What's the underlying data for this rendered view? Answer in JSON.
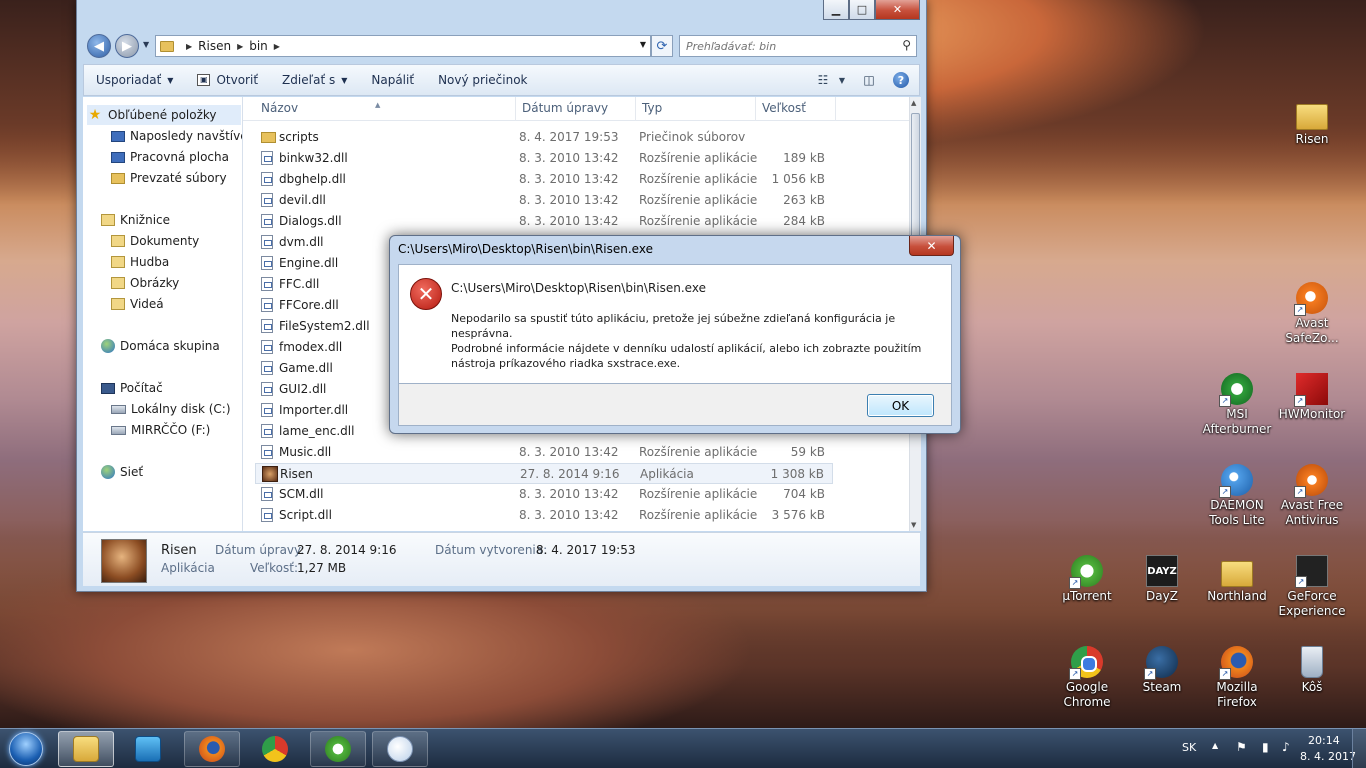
{
  "explorer": {
    "controls": {
      "minimize": "▁",
      "maximize": "□",
      "close": "✕"
    },
    "breadcrumb": [
      "Risen",
      "bin"
    ],
    "search_placeholder": "Prehľadávať: bin",
    "toolbar": {
      "organize": "Usporiadať",
      "open": "Otvoriť",
      "share": "Zdieľať s",
      "burn": "Napáliť",
      "new_folder": "Nový priečinok"
    },
    "nav": {
      "favorites": "Obľúbené položky",
      "recent": "Naposledy navštívené",
      "desktop": "Pracovná plocha",
      "downloads": "Prevzaté súbory",
      "libraries": "Knižnice",
      "documents": "Dokumenty",
      "music": "Hudba",
      "pictures": "Obrázky",
      "videos": "Videá",
      "homegroup": "Domáca skupina",
      "computer": "Počítač",
      "local_disk": "Lokálny disk (C:)",
      "drive_f": "MIRRČČO (F:)",
      "network": "Sieť"
    },
    "columns": {
      "name": "Názov",
      "date": "Dátum úpravy",
      "type": "Typ",
      "size": "Veľkosť"
    },
    "files": [
      {
        "name": "scripts",
        "date": "8. 4. 2017 19:53",
        "type": "Priečinok súborov",
        "size": "",
        "icon": "folder"
      },
      {
        "name": "binkw32.dll",
        "date": "8. 3. 2010 13:42",
        "type": "Rozšírenie aplikácie",
        "size": "189 kB",
        "icon": "dll"
      },
      {
        "name": "dbghelp.dll",
        "date": "8. 3. 2010 13:42",
        "type": "Rozšírenie aplikácie",
        "size": "1 056 kB",
        "icon": "dll"
      },
      {
        "name": "devil.dll",
        "date": "8. 3. 2010 13:42",
        "type": "Rozšírenie aplikácie",
        "size": "263 kB",
        "icon": "dll"
      },
      {
        "name": "Dialogs.dll",
        "date": "8. 3. 2010 13:42",
        "type": "Rozšírenie aplikácie",
        "size": "284 kB",
        "icon": "dll"
      },
      {
        "name": "dvm.dll",
        "date": "",
        "type": "",
        "size": "",
        "icon": "dll"
      },
      {
        "name": "Engine.dll",
        "date": "",
        "type": "",
        "size": "",
        "icon": "dll"
      },
      {
        "name": "FFC.dll",
        "date": "",
        "type": "",
        "size": "",
        "icon": "dll"
      },
      {
        "name": "FFCore.dll",
        "date": "",
        "type": "",
        "size": "",
        "icon": "dll"
      },
      {
        "name": "FileSystem2.dll",
        "date": "",
        "type": "",
        "size": "",
        "icon": "dll"
      },
      {
        "name": "fmodex.dll",
        "date": "",
        "type": "",
        "size": "",
        "icon": "dll"
      },
      {
        "name": "Game.dll",
        "date": "",
        "type": "",
        "size": "",
        "icon": "dll"
      },
      {
        "name": "GUI2.dll",
        "date": "",
        "type": "",
        "size": "",
        "icon": "dll"
      },
      {
        "name": "Importer.dll",
        "date": "",
        "type": "",
        "size": "",
        "icon": "dll"
      },
      {
        "name": "lame_enc.dll",
        "date": "",
        "type": "",
        "size": "",
        "icon": "dll"
      },
      {
        "name": "Music.dll",
        "date": "8. 3. 2010 13:42",
        "type": "Rozšírenie aplikácie",
        "size": "59 kB",
        "icon": "dll"
      },
      {
        "name": "Risen",
        "date": "27. 8. 2014 9:16",
        "type": "Aplikácia",
        "size": "1 308 kB",
        "icon": "app",
        "selected": true
      },
      {
        "name": "SCM.dll",
        "date": "8. 3. 2010 13:42",
        "type": "Rozšírenie aplikácie",
        "size": "704 kB",
        "icon": "dll"
      },
      {
        "name": "Script.dll",
        "date": "8. 3. 2010 13:42",
        "type": "Rozšírenie aplikácie",
        "size": "3 576 kB",
        "icon": "dll"
      }
    ],
    "details": {
      "name": "Risen",
      "type": "Aplikácia",
      "modified_label": "Dátum úpravy:",
      "modified_value": "27. 8. 2014 9:16",
      "size_label": "Veľkosť:",
      "size_value": "1,27 MB",
      "created_label": "Dátum vytvorenia:",
      "created_value": "8. 4. 2017 19:53"
    }
  },
  "dialog": {
    "title": "C:\\Users\\Miro\\Desktop\\Risen\\bin\\Risen.exe",
    "close": "✕",
    "path": "C:\\Users\\Miro\\Desktop\\Risen\\bin\\Risen.exe",
    "message_1": "Nepodarilo sa spustiť túto aplikáciu, pretože jej súbežne zdieľaná konfigurácia je nesprávna.",
    "message_2": "Podrobné informácie nájdete v denníku udalostí aplikácií, alebo ich zobrazte použitím",
    "message_3": "nástroja príkazového riadka sxstrace.exe.",
    "ok": "OK",
    "error_glyph": "✕"
  },
  "desktop_icons": [
    {
      "label": "Risen",
      "icon": "folder-icon"
    },
    {
      "label": "Avast SafeZo...",
      "icon": "avast-safezone-icon"
    },
    {
      "label": "MSI Afterburner",
      "icon": "msi-afterburner-icon"
    },
    {
      "label": "HWMonitor",
      "icon": "hwmonitor-icon"
    },
    {
      "label": "DAEMON Tools Lite",
      "icon": "daemon-tools-icon"
    },
    {
      "label": "Avast Free Antivirus",
      "icon": "avast-antivirus-icon"
    },
    {
      "label": "µTorrent",
      "icon": "utorrent-icon"
    },
    {
      "label": "DayZ",
      "icon": "dayz-icon"
    },
    {
      "label": "Northland",
      "icon": "folder-icon"
    },
    {
      "label": "GeForce Experience",
      "icon": "geforce-icon"
    },
    {
      "label": "Google Chrome",
      "icon": "chrome-icon"
    },
    {
      "label": "Steam",
      "icon": "steam-icon"
    },
    {
      "label": "Mozilla Firefox",
      "icon": "firefox-icon"
    },
    {
      "label": "Kôš",
      "icon": "recycle-bin-icon"
    }
  ],
  "dayz_logo": "DAYZ",
  "taskbar": {
    "language": "SK",
    "time": "20:14",
    "date": "8. 4. 2017"
  }
}
